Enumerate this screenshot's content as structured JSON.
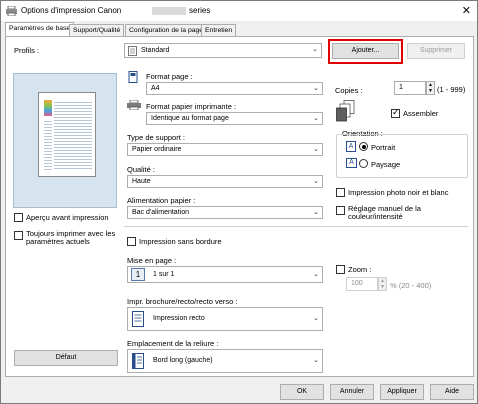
{
  "window": {
    "title": "Options d'impression Canon",
    "title_tail": "series",
    "close": "✕"
  },
  "tabs": [
    {
      "label": "Paramètres de base",
      "active": true
    },
    {
      "label": "Support/Qualité",
      "active": false
    },
    {
      "label": "Configuration de la page",
      "active": false
    },
    {
      "label": "Entretien",
      "active": false
    }
  ],
  "profiles": {
    "label": "Profils :",
    "value": "Standard",
    "add_button": "Ajouter...",
    "delete_button": "Supprimer"
  },
  "preview": {
    "show_preview_label": "Aperçu avant impression",
    "always_print_label": "Toujours imprimer avec les paramètres actuels",
    "default_button": "Défaut"
  },
  "page_size": {
    "label": "Format page :",
    "value": "A4"
  },
  "printer_paper_size": {
    "label": "Format papier imprimante :",
    "value": "Identique au format page"
  },
  "media_type": {
    "label": "Type de support :",
    "value": "Papier ordinaire"
  },
  "quality": {
    "label": "Qualité :",
    "value": "Haute"
  },
  "paper_source": {
    "label": "Alimentation papier :",
    "value": "Bac d'alimentation"
  },
  "borderless": {
    "label": "Impression sans bordure",
    "checked": false
  },
  "layout": {
    "label": "Mise en page :",
    "value": "1 sur 1",
    "icon_digit": "1"
  },
  "duplex": {
    "label": "Impr. brochure/recto/recto verso :",
    "value": "Impression recto"
  },
  "binding": {
    "label": "Emplacement de la reliure :",
    "value": "Bord long (gauche)"
  },
  "copies": {
    "label": "Copies :",
    "value": "1",
    "range": "(1 - 999)",
    "collate_label": "Assembler",
    "collate_checked": true
  },
  "orientation": {
    "label": "Orientation :",
    "portrait": "Portrait",
    "landscape": "Paysage",
    "selected": "Portrait"
  },
  "grayscale": {
    "label": "Impression photo noir et blanc",
    "checked": false
  },
  "manual_color": {
    "label": "Réglage manuel de la couleur/intensité",
    "checked": false
  },
  "zoom": {
    "label": "Zoom :",
    "value": "100",
    "range": "% (20 - 400)",
    "checked": false
  },
  "footer": {
    "ok": "OK",
    "cancel": "Annuler",
    "apply": "Appliquer",
    "help": "Aide"
  },
  "colors": {
    "highlight_red": "#e00000"
  }
}
